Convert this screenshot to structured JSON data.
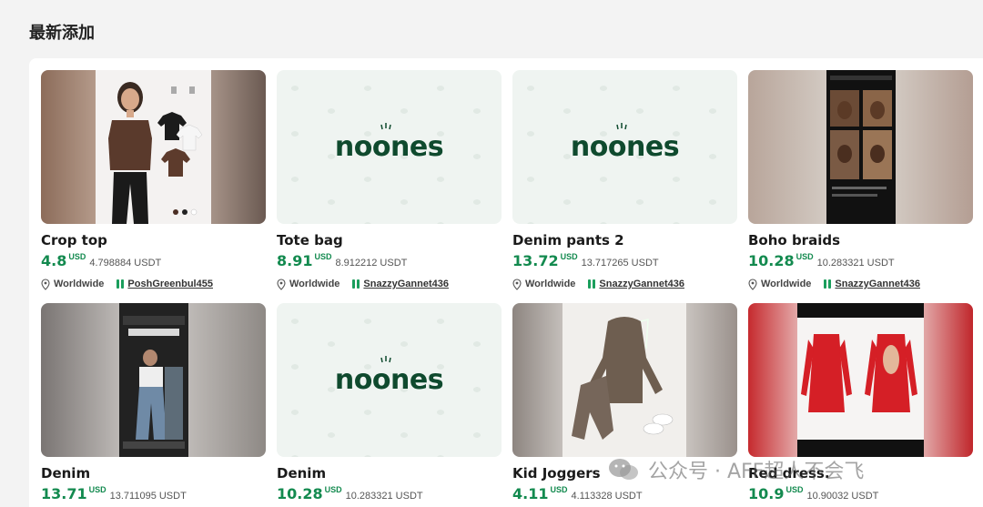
{
  "section": {
    "title": "最新添加"
  },
  "watermark": {
    "text": "公众号 · AFF超人不会飞"
  },
  "colors": {
    "price": "#138a4f",
    "brand": "#0f4a2e",
    "online": "#1a9e5c"
  },
  "listings": [
    {
      "title": "Crop top",
      "price": "4.8",
      "currency": "USD",
      "usdt": "4.798884 USDT",
      "location": "Worldwide",
      "seller": "PoshGreenbul455",
      "image": "photo-crop-top"
    },
    {
      "title": "Tote bag",
      "price": "8.91",
      "currency": "USD",
      "usdt": "8.912212 USDT",
      "location": "Worldwide",
      "seller": "SnazzyGannet436",
      "image": "noones-placeholder"
    },
    {
      "title": "Denim pants 2",
      "price": "13.72",
      "currency": "USD",
      "usdt": "13.717265 USDT",
      "location": "Worldwide",
      "seller": "SnazzyGannet436",
      "image": "noones-placeholder"
    },
    {
      "title": "Boho braids",
      "price": "10.28",
      "currency": "USD",
      "usdt": "10.283321 USDT",
      "location": "Worldwide",
      "seller": "SnazzyGannet436",
      "image": "photo-boho-braids"
    },
    {
      "title": "Denim",
      "price": "13.71",
      "currency": "USD",
      "usdt": "13.711095 USDT",
      "image": "photo-denim"
    },
    {
      "title": "Denim",
      "price": "10.28",
      "currency": "USD",
      "usdt": "10.283321 USDT",
      "image": "noones-placeholder"
    },
    {
      "title": "Kid Joggers",
      "price": "4.11",
      "currency": "USD",
      "usdt": "4.113328 USDT",
      "image": "photo-kid-joggers"
    },
    {
      "title": "Red dress.",
      "price": "10.9",
      "currency": "USD",
      "usdt": "10.90032 USDT",
      "image": "photo-red-dress"
    }
  ],
  "brand": {
    "logo_text": "noones"
  }
}
